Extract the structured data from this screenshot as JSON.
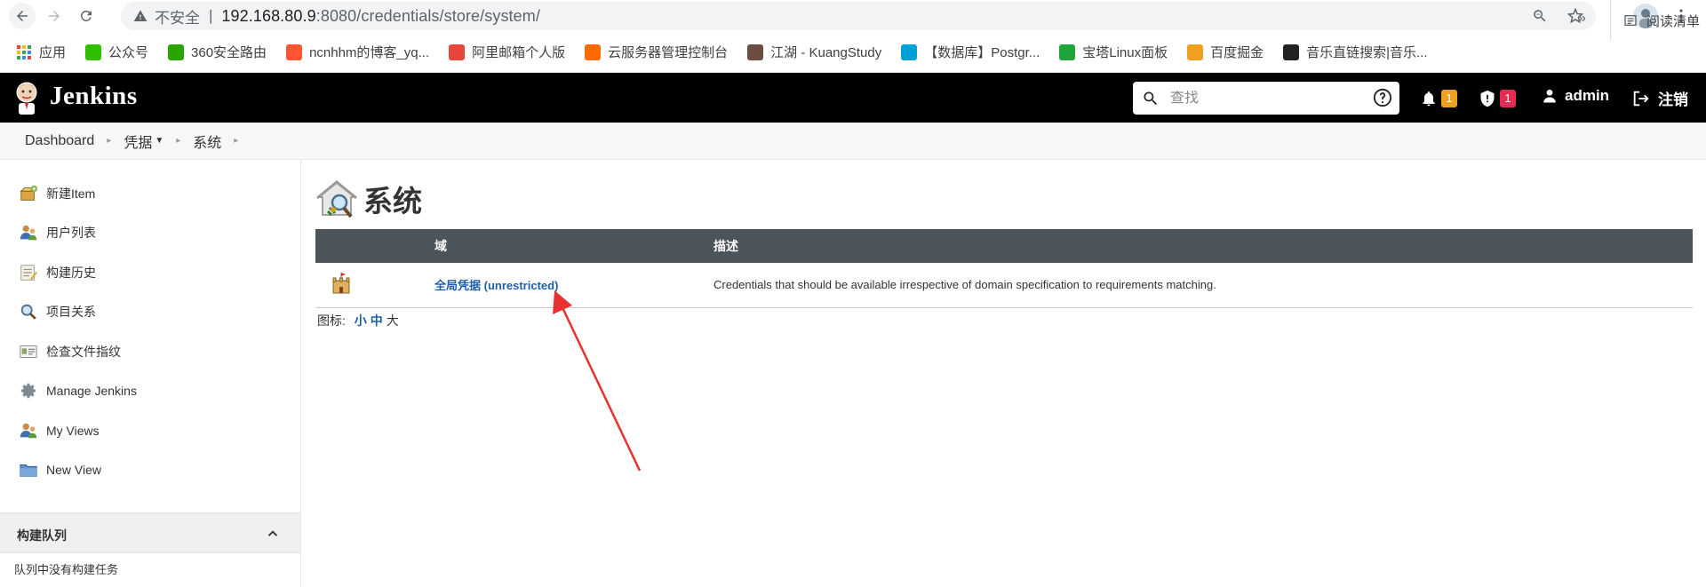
{
  "browser": {
    "insecure_label": "不安全",
    "separator": "|",
    "url_host": "192.168.80.9",
    "url_rest": ":8080/credentials/store/system/",
    "bookmarks": [
      {
        "label": "应用",
        "icon": "apps-grid-icon",
        "color": "#4285f4"
      },
      {
        "label": "公众号",
        "icon": "wechat-icon",
        "color": "#2dc100"
      },
      {
        "label": "360安全路由",
        "icon": "360-icon",
        "color": "#27a600"
      },
      {
        "label": "ncnhhm的博客_yq...",
        "icon": "csdn-icon",
        "color": "#fc5531"
      },
      {
        "label": "阿里邮箱个人版",
        "icon": "mail-icon",
        "color": "#e8453c"
      },
      {
        "label": "云服务器管理控制台",
        "icon": "aliyun-icon",
        "color": "#ff6a00"
      },
      {
        "label": "江湖 - KuangStudy",
        "icon": "kuang-icon",
        "color": "#6d4c41"
      },
      {
        "label": "【数据库】Postgr...",
        "icon": "bilibili-icon",
        "color": "#00a1d6"
      },
      {
        "label": "宝塔Linux面板",
        "icon": "bt-icon",
        "color": "#20a53a"
      },
      {
        "label": "百度掘金",
        "icon": "juejin-icon",
        "color": "#f0a020"
      },
      {
        "label": "音乐直链搜索|音乐...",
        "icon": "liu-icon",
        "color": "#222222"
      }
    ],
    "more": "»",
    "reading_list": "阅读清单"
  },
  "header": {
    "title": "Jenkins",
    "search_placeholder": "查找",
    "notifications_count": "1",
    "security_count": "1",
    "notif_color": "#f0a020",
    "security_color": "#e52b50",
    "user": "admin",
    "logout": "注销"
  },
  "breadcrumb": {
    "dashboard": "Dashboard",
    "credentials": "凭据",
    "system": "系统"
  },
  "sidebar": {
    "items": [
      {
        "label": "新建Item",
        "icon": "new-item-icon"
      },
      {
        "label": "用户列表",
        "icon": "users-icon"
      },
      {
        "label": "构建历史",
        "icon": "build-history-icon"
      },
      {
        "label": "项目关系",
        "icon": "search-magnifier-icon"
      },
      {
        "label": "检查文件指纹",
        "icon": "fingerprint-icon"
      },
      {
        "label": "Manage Jenkins",
        "icon": "gear-icon"
      },
      {
        "label": "My Views",
        "icon": "users-icon"
      },
      {
        "label": "New View",
        "icon": "folder-icon"
      }
    ],
    "queue_title": "构建队列",
    "queue_empty": "队列中没有构建任务"
  },
  "main": {
    "title": "系统",
    "table": {
      "headers": [
        "",
        "域",
        "描述"
      ],
      "rows": [
        {
          "domain": "全局凭据 (unrestricted)",
          "description": "Credentials that should be available irrespective of domain specification to requirements matching."
        }
      ]
    },
    "icon_size_label": "图标:",
    "icon_sizes": [
      "小",
      "中",
      "大"
    ]
  },
  "colors": {
    "header_bg": "#000000",
    "table_header_bg": "#4b535b",
    "link": "#1f5fa6",
    "arrow": "#e8322f"
  }
}
